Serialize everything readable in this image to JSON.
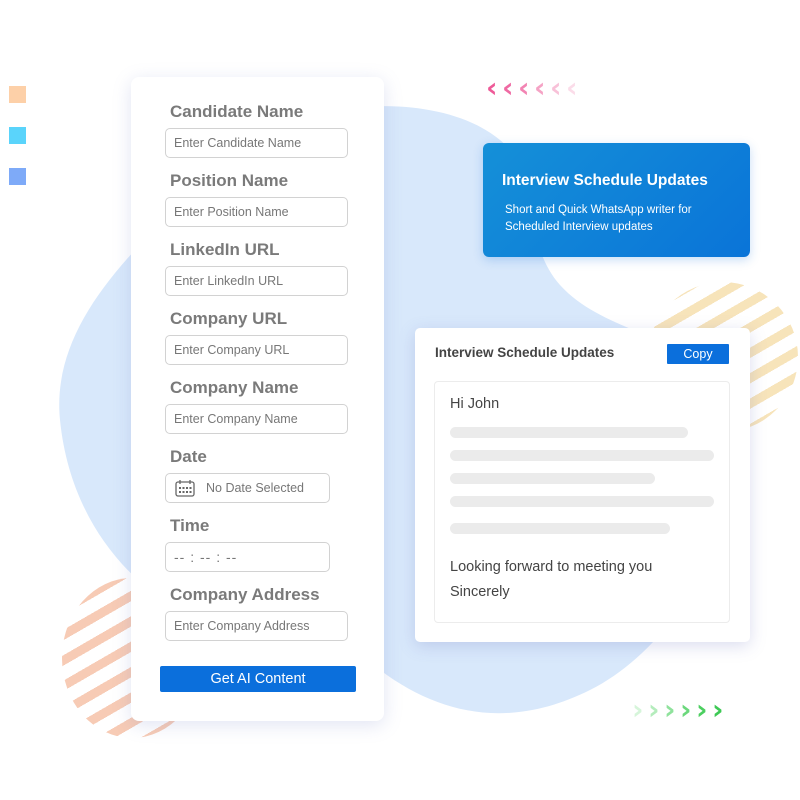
{
  "decorations": {
    "squares": [
      {
        "name": "peach-square",
        "color": "#fdd0a8"
      },
      {
        "name": "cyan-square",
        "color": "#5ad4fb"
      },
      {
        "name": "blue-square",
        "color": "#7eaaf8"
      }
    ],
    "left_chevrons": {
      "glyph": "‹",
      "colors": [
        "#ee5a98",
        "#ef6aa3",
        "#f284b3",
        "#f5a3c5",
        "#f8c1d8",
        "#fbdce9"
      ]
    },
    "right_chevrons": {
      "glyph": "›",
      "colors": [
        "#d6f5da",
        "#b4ecbc",
        "#8fe29c",
        "#6bd87c",
        "#4ccf60",
        "#3ec955"
      ]
    },
    "blob_color": "#d6e8fb"
  },
  "form": {
    "fields": [
      {
        "label": "Candidate Name",
        "placeholder": "Enter Candidate Name"
      },
      {
        "label": "Position Name",
        "placeholder": "Enter Position Name"
      },
      {
        "label": "LinkedIn URL",
        "placeholder": "Enter LinkedIn URL"
      },
      {
        "label": "Company URL",
        "placeholder": "Enter Company URL"
      },
      {
        "label": "Company Name",
        "placeholder": "Enter Company Name"
      }
    ],
    "date": {
      "label": "Date",
      "value": "No Date Selected",
      "icon": "calendar-icon"
    },
    "time": {
      "label": "Time",
      "value": "-- : -- : --"
    },
    "address": {
      "label": "Company Address",
      "placeholder": "Enter Company Address"
    },
    "submit_label": "Get AI Content"
  },
  "promo": {
    "title": "Interview Schedule Updates",
    "subtitle": "Short and Quick WhatsApp writer for Scheduled Interview updates"
  },
  "output": {
    "title": "Interview Schedule Updates",
    "copy_label": "Copy",
    "greeting": "Hi John",
    "placeholder_lines": 5,
    "closing": "Looking forward to meeting you",
    "signoff": "Sincerely"
  },
  "colors": {
    "primary": "#0b6fdc",
    "label_gray": "#7a7a7a"
  }
}
